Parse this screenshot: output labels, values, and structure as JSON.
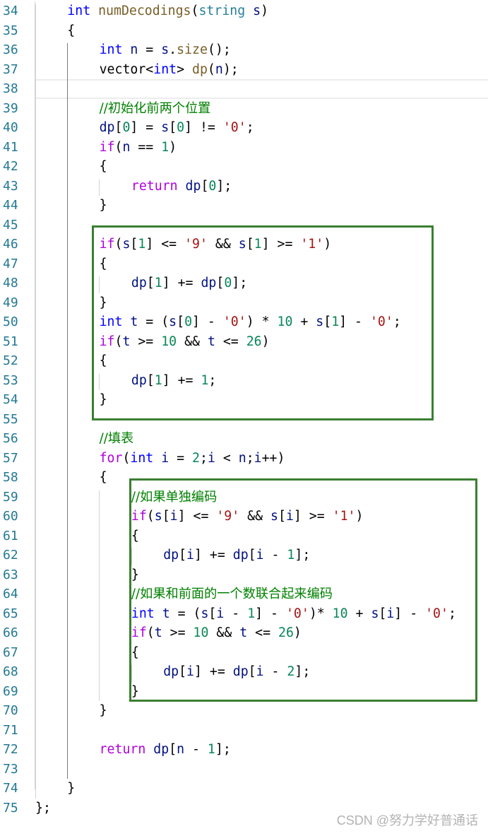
{
  "editor": {
    "current_line": 38,
    "lines": [
      {
        "n": "34",
        "indent": 1,
        "tokens": [
          [
            "kw",
            "int"
          ],
          [
            "",
            "  "
          ],
          [
            "fn",
            "numDecodings"
          ],
          [
            "",
            "("
          ],
          [
            "ty",
            "string"
          ],
          [
            "",
            " "
          ],
          [
            "var",
            "s"
          ],
          [
            "",
            ")"
          ]
        ]
      },
      {
        "n": "35",
        "indent": 1,
        "tokens": [
          [
            "",
            "{"
          ]
        ]
      },
      {
        "n": "36",
        "indent": 2,
        "tokens": [
          [
            "kw",
            "int"
          ],
          [
            "",
            " "
          ],
          [
            "var",
            "n"
          ],
          [
            "",
            " = "
          ],
          [
            "var",
            "s"
          ],
          [
            "",
            "."
          ],
          [
            "fn",
            "size"
          ],
          [
            "",
            "();"
          ]
        ]
      },
      {
        "n": "37",
        "indent": 2,
        "tokens": [
          [
            "",
            "vector<"
          ],
          [
            "kw",
            "int"
          ],
          [
            "",
            "> "
          ],
          [
            "fn",
            "dp"
          ],
          [
            "",
            "("
          ],
          [
            "var",
            "n"
          ],
          [
            "",
            ");"
          ]
        ]
      },
      {
        "n": "38",
        "indent": 2,
        "tokens": []
      },
      {
        "n": "39",
        "indent": 2,
        "tokens": [
          [
            "cm",
            "//初始化前两个位置"
          ]
        ]
      },
      {
        "n": "40",
        "indent": 2,
        "tokens": [
          [
            "var",
            "dp"
          ],
          [
            "",
            "["
          ],
          [
            "num",
            "0"
          ],
          [
            "",
            "] = "
          ],
          [
            "var",
            "s"
          ],
          [
            "",
            "["
          ],
          [
            "num",
            "0"
          ],
          [
            "",
            "] != "
          ],
          [
            "str",
            "'0'"
          ],
          [
            "",
            ";"
          ]
        ]
      },
      {
        "n": "41",
        "indent": 2,
        "tokens": [
          [
            "ctl",
            "if"
          ],
          [
            "",
            "("
          ],
          [
            "var",
            "n"
          ],
          [
            "",
            " == "
          ],
          [
            "num",
            "1"
          ],
          [
            "",
            ")"
          ]
        ]
      },
      {
        "n": "42",
        "indent": 2,
        "tokens": [
          [
            "",
            "{"
          ]
        ]
      },
      {
        "n": "43",
        "indent": 3,
        "tokens": [
          [
            "ctl",
            "return"
          ],
          [
            "",
            " "
          ],
          [
            "var",
            "dp"
          ],
          [
            "",
            "["
          ],
          [
            "num",
            "0"
          ],
          [
            "",
            "];"
          ]
        ]
      },
      {
        "n": "44",
        "indent": 2,
        "tokens": [
          [
            "",
            "}"
          ]
        ]
      },
      {
        "n": "45",
        "indent": 2,
        "tokens": []
      },
      {
        "n": "46",
        "indent": 2,
        "tokens": [
          [
            "ctl",
            "if"
          ],
          [
            "",
            "("
          ],
          [
            "var",
            "s"
          ],
          [
            "",
            "["
          ],
          [
            "num",
            "1"
          ],
          [
            "",
            "] <= "
          ],
          [
            "str",
            "'9'"
          ],
          [
            "",
            " && "
          ],
          [
            "var",
            "s"
          ],
          [
            "",
            "["
          ],
          [
            "num",
            "1"
          ],
          [
            "",
            "] >= "
          ],
          [
            "str",
            "'1'"
          ],
          [
            "",
            ")"
          ]
        ]
      },
      {
        "n": "47",
        "indent": 2,
        "tokens": [
          [
            "",
            "{"
          ]
        ]
      },
      {
        "n": "48",
        "indent": 3,
        "tokens": [
          [
            "var",
            "dp"
          ],
          [
            "",
            "["
          ],
          [
            "num",
            "1"
          ],
          [
            "",
            "] += "
          ],
          [
            "var",
            "dp"
          ],
          [
            "",
            "["
          ],
          [
            "num",
            "0"
          ],
          [
            "",
            "];"
          ]
        ]
      },
      {
        "n": "49",
        "indent": 2,
        "tokens": [
          [
            "",
            "}"
          ]
        ]
      },
      {
        "n": "50",
        "indent": 2,
        "tokens": [
          [
            "kw",
            "int"
          ],
          [
            "",
            " "
          ],
          [
            "var",
            "t"
          ],
          [
            "",
            " = ("
          ],
          [
            "var",
            "s"
          ],
          [
            "",
            "["
          ],
          [
            "num",
            "0"
          ],
          [
            "",
            "] - "
          ],
          [
            "str",
            "'0'"
          ],
          [
            "",
            ") * "
          ],
          [
            "num",
            "10"
          ],
          [
            "",
            " + "
          ],
          [
            "var",
            "s"
          ],
          [
            "",
            "["
          ],
          [
            "num",
            "1"
          ],
          [
            "",
            "] - "
          ],
          [
            "str",
            "'0'"
          ],
          [
            "",
            ";"
          ]
        ]
      },
      {
        "n": "51",
        "indent": 2,
        "tokens": [
          [
            "ctl",
            "if"
          ],
          [
            "",
            "("
          ],
          [
            "var",
            "t"
          ],
          [
            "",
            " >= "
          ],
          [
            "num",
            "10"
          ],
          [
            "",
            " && "
          ],
          [
            "var",
            "t"
          ],
          [
            "",
            " <= "
          ],
          [
            "num",
            "26"
          ],
          [
            "",
            ")"
          ]
        ]
      },
      {
        "n": "52",
        "indent": 2,
        "tokens": [
          [
            "",
            "{"
          ]
        ]
      },
      {
        "n": "53",
        "indent": 3,
        "tokens": [
          [
            "var",
            "dp"
          ],
          [
            "",
            "["
          ],
          [
            "num",
            "1"
          ],
          [
            "",
            "] += "
          ],
          [
            "num",
            "1"
          ],
          [
            "",
            ";"
          ]
        ]
      },
      {
        "n": "54",
        "indent": 2,
        "tokens": [
          [
            "",
            "}"
          ]
        ]
      },
      {
        "n": "55",
        "indent": 2,
        "tokens": []
      },
      {
        "n": "56",
        "indent": 2,
        "tokens": [
          [
            "cm",
            "//填表"
          ]
        ]
      },
      {
        "n": "57",
        "indent": 2,
        "tokens": [
          [
            "ctl",
            "for"
          ],
          [
            "",
            "("
          ],
          [
            "kw",
            "int"
          ],
          [
            "",
            " "
          ],
          [
            "var",
            "i"
          ],
          [
            "",
            " = "
          ],
          [
            "num",
            "2"
          ],
          [
            "",
            ";"
          ],
          [
            "var",
            "i"
          ],
          [
            "",
            " < "
          ],
          [
            "var",
            "n"
          ],
          [
            "",
            ";"
          ],
          [
            "var",
            "i"
          ],
          [
            "",
            "++)"
          ]
        ]
      },
      {
        "n": "58",
        "indent": 2,
        "tokens": [
          [
            "",
            "{"
          ]
        ]
      },
      {
        "n": "59",
        "indent": 3,
        "tokens": [
          [
            "cm",
            "//如果单独编码"
          ]
        ]
      },
      {
        "n": "60",
        "indent": 3,
        "tokens": [
          [
            "ctl",
            "if"
          ],
          [
            "",
            "("
          ],
          [
            "var",
            "s"
          ],
          [
            "",
            "["
          ],
          [
            "var",
            "i"
          ],
          [
            "",
            "] <= "
          ],
          [
            "str",
            "'9'"
          ],
          [
            "",
            " && "
          ],
          [
            "var",
            "s"
          ],
          [
            "",
            "["
          ],
          [
            "var",
            "i"
          ],
          [
            "",
            "] >= "
          ],
          [
            "str",
            "'1'"
          ],
          [
            "",
            ")"
          ]
        ]
      },
      {
        "n": "61",
        "indent": 3,
        "tokens": [
          [
            "",
            "{"
          ]
        ]
      },
      {
        "n": "62",
        "indent": 4,
        "tokens": [
          [
            "var",
            "dp"
          ],
          [
            "",
            "["
          ],
          [
            "var",
            "i"
          ],
          [
            "",
            "] += "
          ],
          [
            "var",
            "dp"
          ],
          [
            "",
            "["
          ],
          [
            "var",
            "i"
          ],
          [
            "",
            " - "
          ],
          [
            "num",
            "1"
          ],
          [
            "",
            "];"
          ]
        ]
      },
      {
        "n": "63",
        "indent": 3,
        "tokens": [
          [
            "",
            "}"
          ]
        ]
      },
      {
        "n": "64",
        "indent": 3,
        "tokens": [
          [
            "cm",
            "//如果和前面的一个数联合起来编码"
          ]
        ]
      },
      {
        "n": "65",
        "indent": 3,
        "tokens": [
          [
            "kw",
            "int"
          ],
          [
            "",
            " "
          ],
          [
            "var",
            "t"
          ],
          [
            "",
            " = ("
          ],
          [
            "var",
            "s"
          ],
          [
            "",
            "["
          ],
          [
            "var",
            "i"
          ],
          [
            "",
            " - "
          ],
          [
            "num",
            "1"
          ],
          [
            "",
            "] - "
          ],
          [
            "str",
            "'0'"
          ],
          [
            "",
            ")* "
          ],
          [
            "num",
            "10"
          ],
          [
            "",
            " + "
          ],
          [
            "var",
            "s"
          ],
          [
            "",
            "["
          ],
          [
            "var",
            "i"
          ],
          [
            "",
            "] - "
          ],
          [
            "str",
            "'0'"
          ],
          [
            "",
            ";"
          ]
        ]
      },
      {
        "n": "66",
        "indent": 3,
        "tokens": [
          [
            "ctl",
            "if"
          ],
          [
            "",
            "("
          ],
          [
            "var",
            "t"
          ],
          [
            "",
            " >= "
          ],
          [
            "num",
            "10"
          ],
          [
            "",
            " && "
          ],
          [
            "var",
            "t"
          ],
          [
            "",
            " <= "
          ],
          [
            "num",
            "26"
          ],
          [
            "",
            ")"
          ]
        ]
      },
      {
        "n": "67",
        "indent": 3,
        "tokens": [
          [
            "",
            "{"
          ]
        ]
      },
      {
        "n": "68",
        "indent": 4,
        "tokens": [
          [
            "var",
            "dp"
          ],
          [
            "",
            "["
          ],
          [
            "var",
            "i"
          ],
          [
            "",
            "] += "
          ],
          [
            "var",
            "dp"
          ],
          [
            "",
            "["
          ],
          [
            "var",
            "i"
          ],
          [
            "",
            " - "
          ],
          [
            "num",
            "2"
          ],
          [
            "",
            "];"
          ]
        ]
      },
      {
        "n": "69",
        "indent": 3,
        "tokens": [
          [
            "",
            "}"
          ]
        ]
      },
      {
        "n": "70",
        "indent": 2,
        "tokens": [
          [
            "",
            "}"
          ]
        ]
      },
      {
        "n": "71",
        "indent": 2,
        "tokens": []
      },
      {
        "n": "72",
        "indent": 2,
        "tokens": [
          [
            "ctl",
            "return"
          ],
          [
            "",
            " "
          ],
          [
            "var",
            "dp"
          ],
          [
            "",
            "["
          ],
          [
            "var",
            "n"
          ],
          [
            "",
            " - "
          ],
          [
            "num",
            "1"
          ],
          [
            "",
            "];"
          ]
        ]
      },
      {
        "n": "73",
        "indent": 2,
        "tokens": []
      },
      {
        "n": "74",
        "indent": 1,
        "tokens": [
          [
            "",
            "}"
          ]
        ]
      },
      {
        "n": "75",
        "indent": 0,
        "tokens": [
          [
            "",
            "};"
          ]
        ]
      }
    ]
  },
  "highlight_boxes": [
    {
      "label": "init-dp1-block",
      "from_line": "45",
      "to_line": "55",
      "color": "#3a7f32"
    },
    {
      "label": "loop-body-block",
      "from_line": "59",
      "to_line": "69",
      "color": "#3a7f32"
    }
  ],
  "watermark": "CSDN @努力学好普通话"
}
